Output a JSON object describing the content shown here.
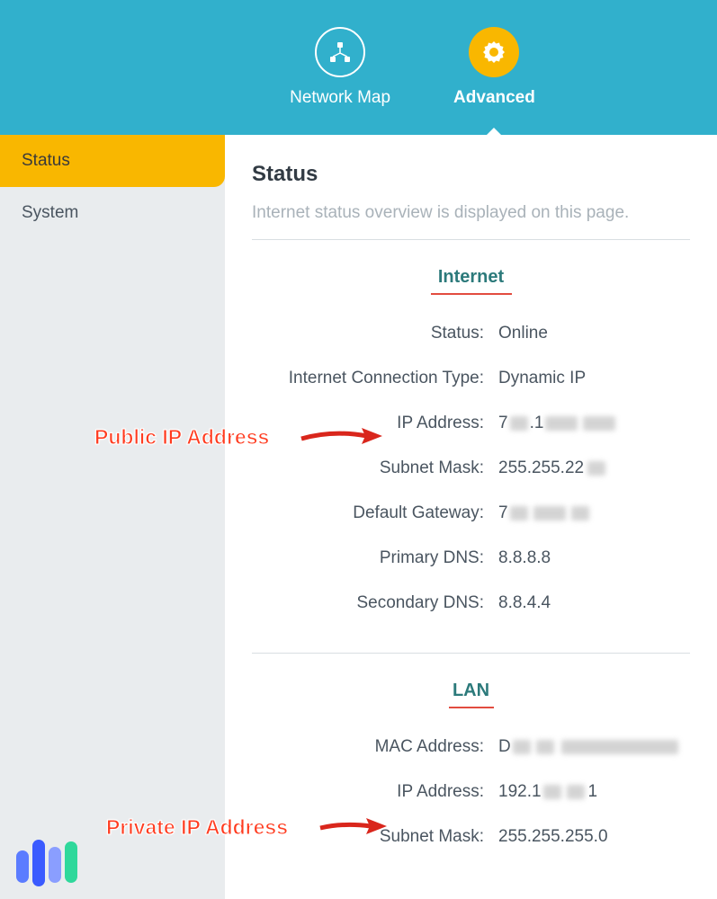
{
  "nav": {
    "items": [
      {
        "label": "Network Map",
        "active": false
      },
      {
        "label": "Advanced",
        "active": true
      }
    ]
  },
  "sidebar": {
    "items": [
      {
        "label": "Status",
        "active": true
      },
      {
        "label": "System",
        "active": false
      }
    ]
  },
  "page": {
    "title": "Status",
    "subtitle": "Internet status overview is displayed on this page."
  },
  "sections": {
    "internet": {
      "title": "Internet",
      "fields": {
        "status_label": "Status:",
        "status_value": "Online",
        "conn_type_label": "Internet Connection Type:",
        "conn_type_value": "Dynamic IP",
        "ip_label": "IP Address:",
        "ip_prefix": "7",
        "subnet_label": "Subnet Mask:",
        "subnet_prefix": "255.255.22",
        "gateway_label": "Default Gateway:",
        "gateway_prefix": "7",
        "pdns_label": "Primary DNS:",
        "pdns_value": "8.8.8.8",
        "sdns_label": "Secondary DNS:",
        "sdns_value": "8.8.4.4"
      }
    },
    "lan": {
      "title": "LAN",
      "fields": {
        "mac_label": "MAC Address:",
        "mac_prefix": "D",
        "ip_label": "IP Address:",
        "ip_prefix": "192.1",
        "ip_suffix": "1",
        "subnet_label": "Subnet Mask:",
        "subnet_value": "255.255.255.0"
      }
    }
  },
  "annotations": {
    "public": "Public IP Address",
    "private": "Private IP Address"
  }
}
